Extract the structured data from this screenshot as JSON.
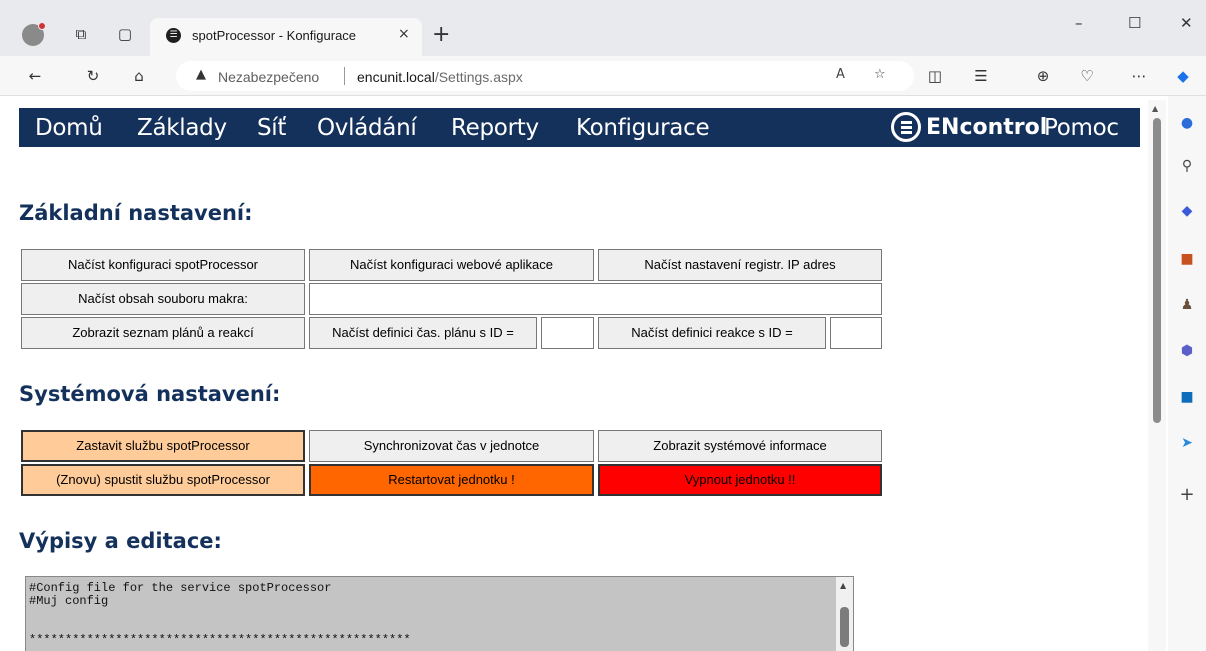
{
  "browser": {
    "tab_title": "spotProcessor - Konfigurace",
    "tab_close": "×",
    "new_tab": "+",
    "security_label": "Nezabezpečeno",
    "url_host": "encunit.local",
    "url_path": "/Settings.aspx",
    "window_controls": [
      "–",
      "☐",
      "✕"
    ]
  },
  "nav": {
    "items": [
      "Domů",
      "Základy",
      "Síť",
      "Ovládání",
      "Reporty",
      "Konfigurace"
    ],
    "brand": "ENcontrol",
    "help": "Pomoc"
  },
  "sections": {
    "basic": {
      "title": "Základní nastavení:",
      "load_spot_config": "Načíst konfiguraci spotProcessor",
      "load_web_config": "Načíst konfiguraci webové aplikace",
      "load_ip_reg": "Načíst nastavení registr. IP adres",
      "load_macro_file": "Načíst obsah souboru makra:",
      "macro_file_value": "",
      "show_plans": "Zobrazit seznam plánů a reakcí",
      "load_plan_def": "Načíst definici čas. plánu s ID =",
      "plan_id_value": "",
      "load_reaction_def": "Načíst definici reakce s ID =",
      "reaction_id_value": ""
    },
    "system": {
      "title": "Systémová nastavení:",
      "stop_service": "Zastavit službu spotProcessor",
      "sync_time": "Synchronizovat čas v jednotce",
      "show_sysinfo": "Zobrazit systémové informace",
      "restart_service": "(Znovu) spustit službu spotProcessor",
      "restart_unit": "Restartovat jednotku !",
      "shutdown_unit": "Vypnout jednotku !!"
    },
    "listings": {
      "title": "Výpisy a editace:",
      "content": "#Config file for the service spotProcessor\n#Muj config\n\n\n*****************************************************"
    }
  },
  "colors": {
    "nav_bg": "#14315c",
    "heading": "#14315c",
    "peach": "#ffcc99",
    "orange": "#ff6600",
    "red": "#ff0000"
  }
}
